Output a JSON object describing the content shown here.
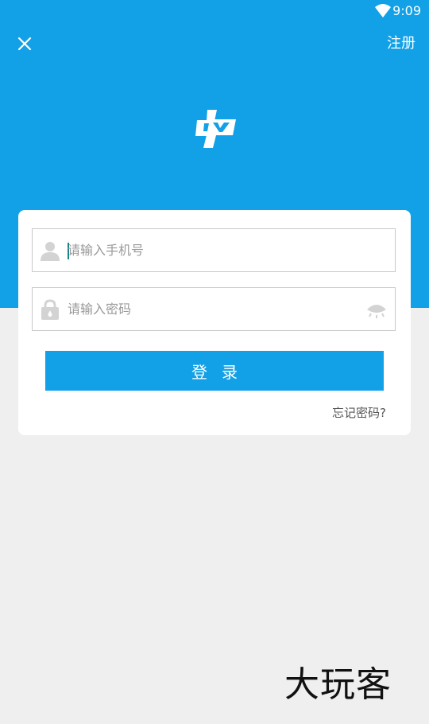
{
  "status_bar": {
    "time": "9:09",
    "icons": [
      "wifi-icon"
    ]
  },
  "header": {
    "close_icon": "close-icon",
    "register_label": "注册"
  },
  "logo": {
    "icon": "brand-logo-icon"
  },
  "login_form": {
    "phone": {
      "placeholder": "请输入手机号",
      "value": "",
      "icon": "user-icon"
    },
    "password": {
      "placeholder": "请输入密码",
      "value": "",
      "icon": "lock-icon",
      "toggle_icon": "eye-icon"
    },
    "submit_label": "登录",
    "forgot_label": "忘记密码?"
  },
  "watermark": {
    "text": "大玩客"
  },
  "colors": {
    "primary": "#12a1e7",
    "page_background": "#efefef",
    "card_background": "#ffffff",
    "border": "#c9c9c9",
    "placeholder": "#9a9a9a",
    "icon_gray": "#d3d3d3"
  }
}
